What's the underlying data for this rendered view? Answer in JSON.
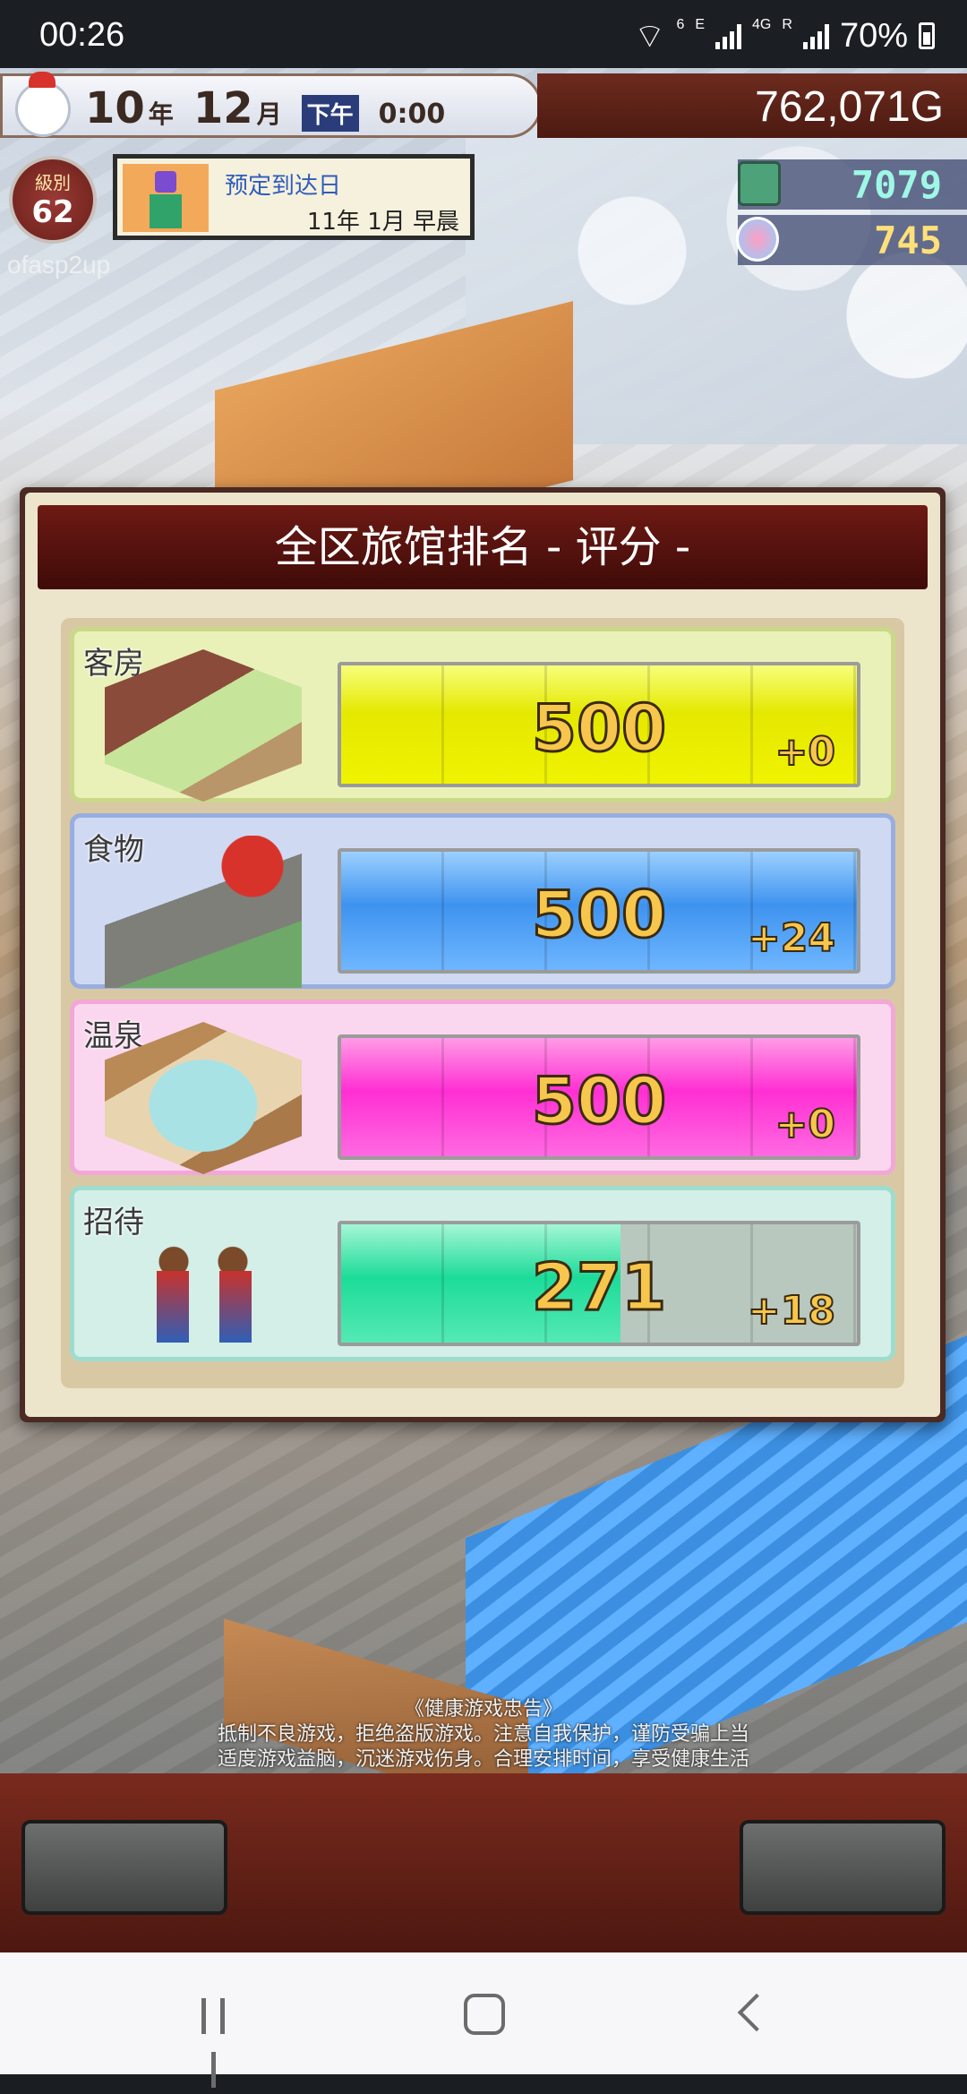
{
  "status_bar": {
    "time": "00:26",
    "network_small_1": "6",
    "network_small_2": "E",
    "network_small_3": "4G",
    "network_small_4": "R",
    "battery": "70%"
  },
  "hud": {
    "date": {
      "year": "10",
      "year_unit": "年",
      "month": "12",
      "month_unit": "月",
      "period": "下午",
      "clock": "0:00"
    },
    "money": "762,071G",
    "level_label": "級別",
    "level": "62",
    "booking_title": "预定到达日",
    "booking_date": "11年 1月 早晨",
    "watermark": "ofasp2up",
    "resource_1": "7079",
    "resource_2": "745"
  },
  "modal": {
    "title": "全区旅馆排名 - 评分 -",
    "rows": [
      {
        "label": "客房",
        "score": "500",
        "delta": "+0",
        "fill": 1.0
      },
      {
        "label": "食物",
        "score": "500",
        "delta": "+24",
        "fill": 1.0
      },
      {
        "label": "温泉",
        "score": "500",
        "delta": "+0",
        "fill": 1.0
      },
      {
        "label": "招待",
        "score": "271",
        "delta": "+18",
        "fill": 0.542
      }
    ]
  },
  "notice": {
    "line1": "《健康游戏忠告》",
    "line2": "抵制不良游戏，拒绝盗版游戏。注意自我保护，谨防受骗上当",
    "line3": "适度游戏益脑，沉迷游戏伤身。合理安排时间，享受健康生活"
  }
}
